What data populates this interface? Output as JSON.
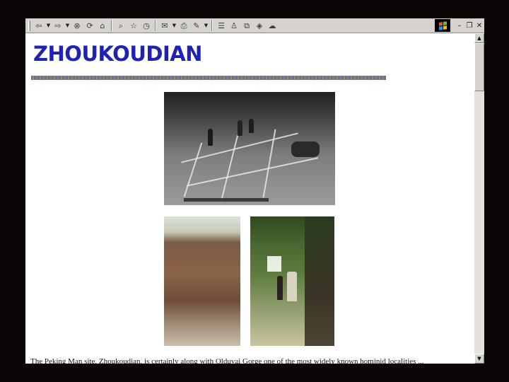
{
  "window": {
    "controls": {
      "minimize": "–",
      "restore": "❐",
      "close": "✕"
    }
  },
  "toolbar": {
    "icons": [
      "back-icon",
      "forward-icon",
      "stop-icon",
      "refresh-icon",
      "home-icon",
      "search-icon",
      "favorites-icon",
      "history-icon",
      "mail-icon",
      "print-icon",
      "edit-icon",
      "discuss-icon",
      "messenger-icon",
      "related-icon",
      "research-icon"
    ]
  },
  "page": {
    "title": "ZHOUKOUDIAN",
    "body_text": "The Peking Man site, Zhoukoudian, is certainly along with Olduvai Gorge one of the most widely known hominid localities ..."
  },
  "colors": {
    "title": "#1f23b4",
    "toolbar": "#d6d3ce",
    "frame": "#0a0605"
  }
}
